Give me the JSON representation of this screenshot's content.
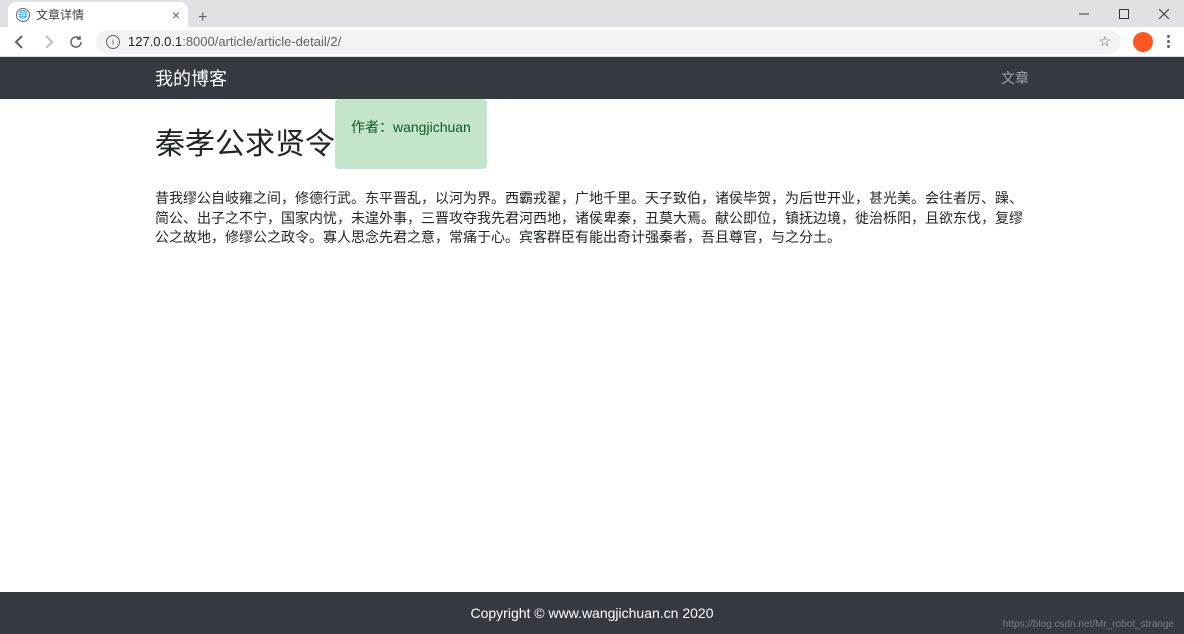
{
  "browser": {
    "tab_title": "文章详情",
    "url_host": "127.0.0.1",
    "url_port": ":8000",
    "url_path": "/article/article-detail/2/"
  },
  "navbar": {
    "brand": "我的博客",
    "link": "文章"
  },
  "article": {
    "title": "秦孝公求贤令",
    "author_label": "作者：",
    "author_name": "wangjichuan",
    "body": "昔我缪公自岐雍之间，修德行武。东平晋乱，以河为界。西霸戎翟，广地千里。天子致伯，诸侯毕贺，为后世开业，甚光美。会往者厉、躁、简公、出子之不宁，国家内忧，未遑外事，三晋攻夺我先君河西地，诸侯卑秦，丑莫大焉。献公即位，镇抚边境，徙治栎阳，且欲东伐，复缪公之故地，修缪公之政令。寡人思念先君之意，常痛于心。宾客群臣有能出奇计强秦者，吾且尊官，与之分土。"
  },
  "footer": {
    "copyright": "Copyright © www.wangjichuan.cn 2020",
    "watermark": "https://blog.csdn.net/Mr_robot_strange"
  }
}
